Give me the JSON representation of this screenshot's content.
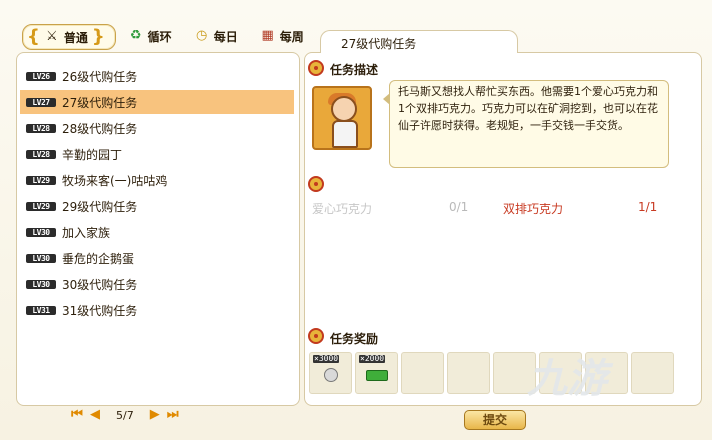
{
  "tabs": [
    {
      "label": "普通",
      "icon": "sword-icon",
      "active": true
    },
    {
      "label": "循环",
      "icon": "recycle-icon",
      "active": false
    },
    {
      "label": "每日",
      "icon": "clock-icon",
      "active": false
    },
    {
      "label": "每周",
      "icon": "calendar-icon",
      "active": false
    }
  ],
  "quests": [
    {
      "level": "LV26",
      "name": "26级代购任务",
      "selected": false
    },
    {
      "level": "LV27",
      "name": "27级代购任务",
      "selected": true
    },
    {
      "level": "LV28",
      "name": "28级代购任务",
      "selected": false
    },
    {
      "level": "LV28",
      "name": "辛勤的园丁",
      "selected": false
    },
    {
      "level": "LV29",
      "name": "牧场来客(一)咕咕鸡",
      "selected": false
    },
    {
      "level": "LV29",
      "name": "29级代购任务",
      "selected": false
    },
    {
      "level": "LV30",
      "name": "加入家族",
      "selected": false
    },
    {
      "level": "LV30",
      "name": "垂危的企鹅蛋",
      "selected": false
    },
    {
      "level": "LV30",
      "name": "30级代购任务",
      "selected": false
    },
    {
      "level": "LV31",
      "name": "31级代购任务",
      "selected": false
    }
  ],
  "pager": {
    "text": "5/7"
  },
  "detail": {
    "tab_title": "27级代购任务",
    "desc_title": "任务描述",
    "description": "托马斯又想找人帮忙买东西。他需要1个爱心巧克力和1个双排巧克力。巧克力可以在矿洞挖到，也可以在花仙子许愿时获得。老规矩，一手交钱一手交货。",
    "requirements": [
      {
        "name": "爱心巧克力",
        "count": "0/1",
        "done": false
      },
      {
        "name": "双排巧克力",
        "count": "1/1",
        "done": true
      }
    ],
    "reward_title": "任务奖励",
    "rewards": [
      {
        "count": "×3000",
        "icon": "coin-icon"
      },
      {
        "count": "×2000",
        "icon": "cash-icon"
      }
    ]
  },
  "submit_label": "提交",
  "watermark": "九游",
  "colors": {
    "accent": "#f8c37e",
    "req_done": "#c83a22",
    "req_pending": "#c7c7c7"
  }
}
